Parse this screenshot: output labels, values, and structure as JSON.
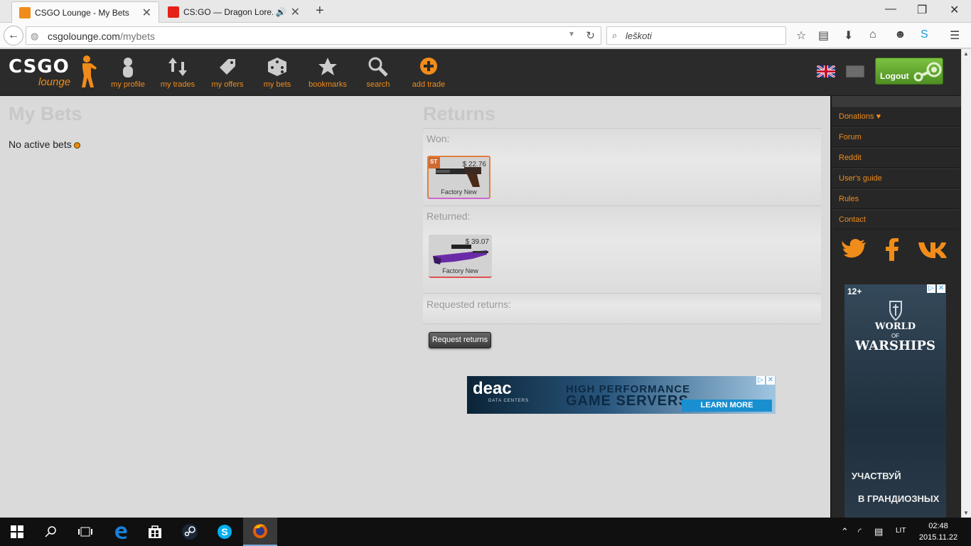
{
  "browser": {
    "tabs": [
      {
        "title": "CSGO Lounge - My Bets",
        "active": true
      },
      {
        "title": "CS:GO — Dragon Lore...",
        "active": false
      }
    ],
    "address": {
      "host": "csgolounge.com",
      "path": "/mybets"
    },
    "search": {
      "value": "leškoti"
    }
  },
  "site": {
    "logo": {
      "main": "CSGO",
      "sub": "lounge"
    },
    "nav": [
      {
        "label": "my profile",
        "icon": "person-icon"
      },
      {
        "label": "my trades",
        "icon": "trade-arrows-icon"
      },
      {
        "label": "my offers",
        "icon": "tag-icon"
      },
      {
        "label": "my bets",
        "icon": "dice-icon"
      },
      {
        "label": "bookmarks",
        "icon": "star-icon"
      },
      {
        "label": "search",
        "icon": "search-icon"
      },
      {
        "label": "add trade",
        "icon": "plus-circle-icon"
      }
    ],
    "logout_label": "Logout",
    "accent": "#f08c1a"
  },
  "mybets": {
    "title": "My Bets",
    "empty_text": "No active bets"
  },
  "returns": {
    "title": "Returns",
    "won_label": "Won:",
    "won_items": [
      {
        "price": "$ 22.76",
        "condition": "Factory New",
        "badge": "ST"
      }
    ],
    "returned_label": "Returned:",
    "returned_items": [
      {
        "price": "$ 39.07",
        "condition": "Factory New"
      }
    ],
    "requested_label": "Requested returns:",
    "request_button": "Request returns"
  },
  "ad_banner": {
    "brand": "deac",
    "brand_sub": "DATA CENTERS",
    "headline1": "HIGH PERFORMANCE",
    "headline2": "GAME SERVERS",
    "cta": "LEARN MORE"
  },
  "sidebar": {
    "links": [
      {
        "label": "Donations ♥"
      },
      {
        "label": "Forum"
      },
      {
        "label": "Reddit"
      },
      {
        "label": "User's guide"
      },
      {
        "label": "Rules"
      },
      {
        "label": "Contact"
      }
    ],
    "social": [
      "twitter-icon",
      "facebook-icon",
      "vk-icon"
    ]
  },
  "side_ad": {
    "age": "12+",
    "t1": "WORLD",
    "t2": "OF",
    "t3": "WARSHIPS",
    "r1": "УЧАСТВУЙ",
    "r2": "В ГРАНДИОЗНЫХ"
  },
  "taskbar": {
    "lang": "LIT",
    "time": "02:48",
    "date": "2015.11.22"
  }
}
